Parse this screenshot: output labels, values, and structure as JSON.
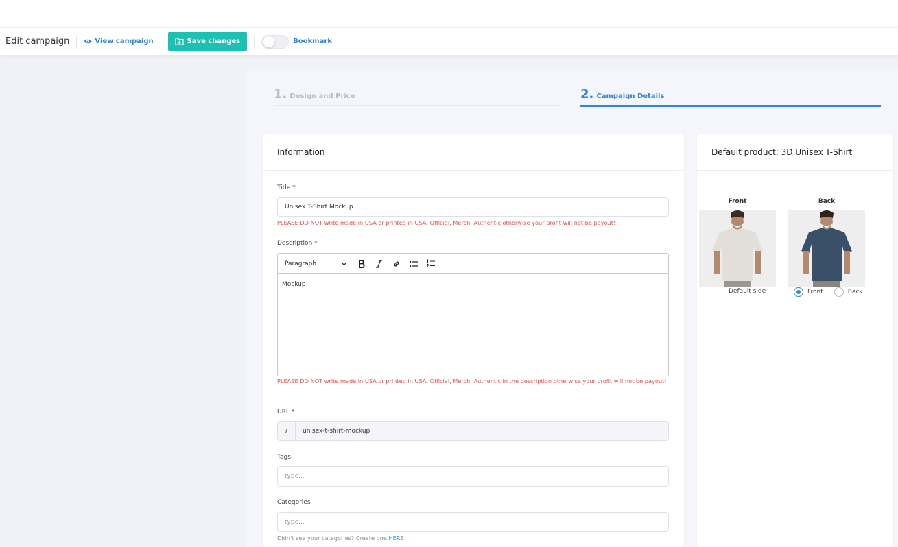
{
  "toolbar": {
    "page_title": "Edit campaign",
    "view_campaign": "View campaign",
    "save_changes": "Save changes",
    "bookmark": "Bookmark",
    "bookmark_on": false
  },
  "steps": [
    {
      "number": "1.",
      "label": "Design and Price",
      "active": false
    },
    {
      "number": "2.",
      "label": "Campaign Details",
      "active": true
    }
  ],
  "information": {
    "heading": "Information",
    "title_label": "Title *",
    "title_value": "Unisex T-Shirt Mockup",
    "title_warning": "PLEASE DO NOT write made in USA or printed in USA, Official, Merch, Authentic otherwise your profit will not be payout!",
    "description_label": "Description *",
    "editor_format": "Paragraph",
    "description_value": "Mockup",
    "description_warning": "PLEASE DO NOT write made in USA or printed in USA, Official, Merch, Authentic in the description otherwise your profit will not be payout!",
    "url_label": "URL *",
    "url_prefix": "/",
    "url_value": "unisex-t-shirt-mockup",
    "tags_label": "Tags",
    "tags_placeholder": "type...",
    "categories_label": "Categories",
    "categories_placeholder": "type...",
    "categories_hint": "Didn't see your categories? Create one",
    "categories_hint_link": "HERE"
  },
  "product": {
    "heading": "Default product: 3D Unisex T-Shirt",
    "front_label": "Front",
    "back_label": "Back",
    "default_side_label": "Default side",
    "options": [
      "Front",
      "Back"
    ],
    "selected": "Front",
    "colors": {
      "front_shirt": "#e6e4de",
      "back_shirt": "#3a5068",
      "accent": "#2f86d8",
      "save_button": "#1cc1b3"
    }
  }
}
